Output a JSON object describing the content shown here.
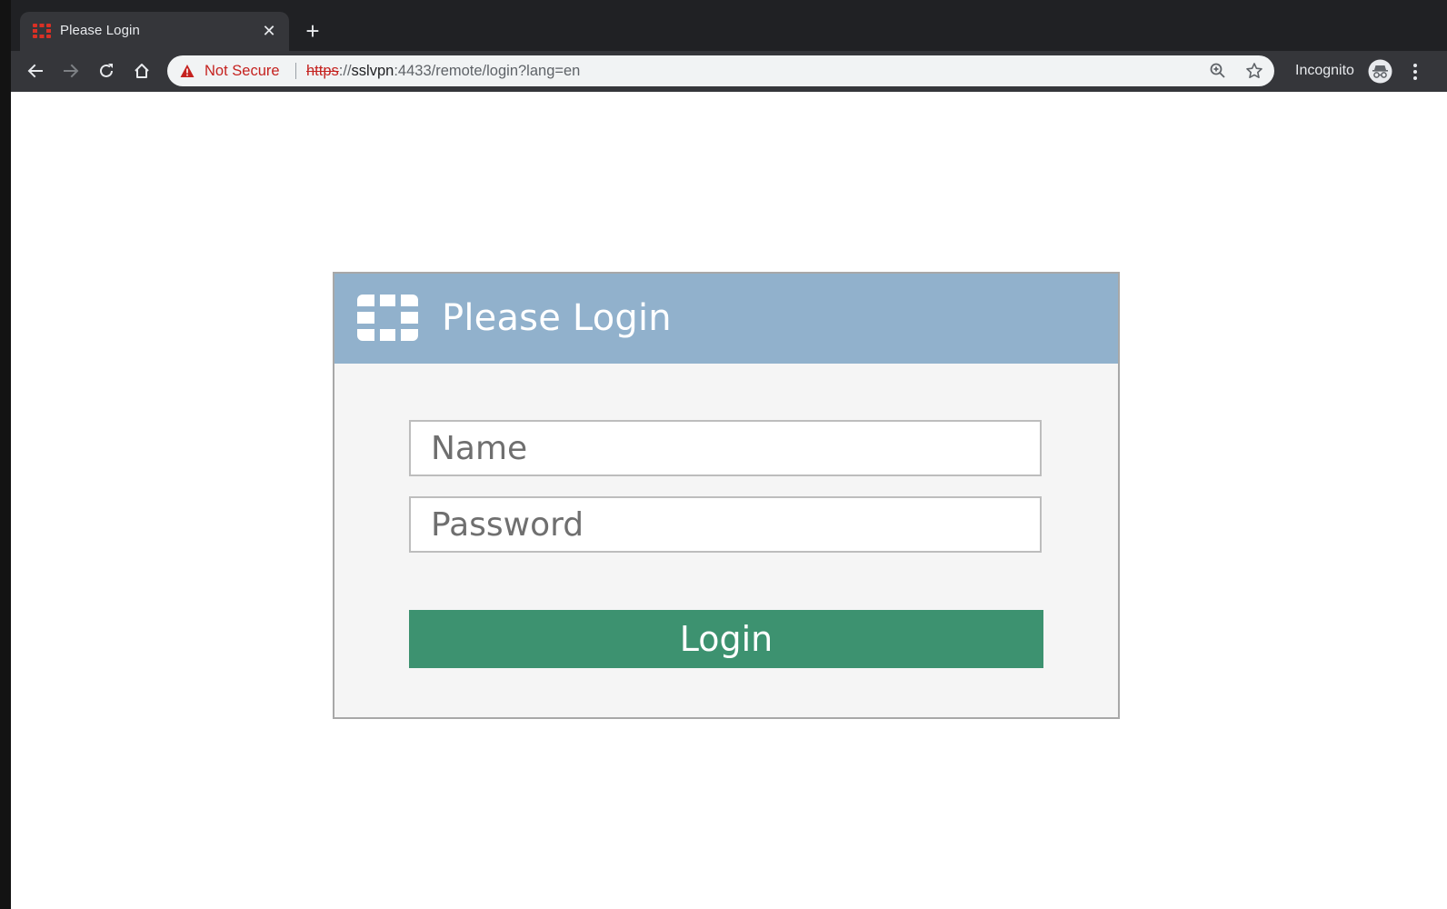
{
  "browser": {
    "tab": {
      "title": "Please Login",
      "close_glyph": "✕"
    },
    "new_tab_glyph": "+",
    "omnibox": {
      "security_label": "Not Secure",
      "url_scheme": "https",
      "url_separator": "://",
      "url_host": "sslvpn",
      "url_rest": ":4433/remote/login?lang=en"
    },
    "profile_label": "Incognito",
    "colors": {
      "insecure_red": "#c5221f",
      "toolbar": "#35363a",
      "tabstrip": "#202124"
    },
    "icons": [
      "back-arrow-icon",
      "forward-arrow-icon",
      "reload-icon",
      "home-icon",
      "warning-icon",
      "zoom-icon",
      "star-icon",
      "incognito-icon",
      "kebab-menu-icon"
    ]
  },
  "login": {
    "title": "Please Login",
    "name_placeholder": "Name",
    "password_placeholder": "Password",
    "submit_label": "Login",
    "colors": {
      "header": "#91b1cc",
      "button": "#3d9270",
      "card_bg": "#f5f5f5"
    }
  }
}
